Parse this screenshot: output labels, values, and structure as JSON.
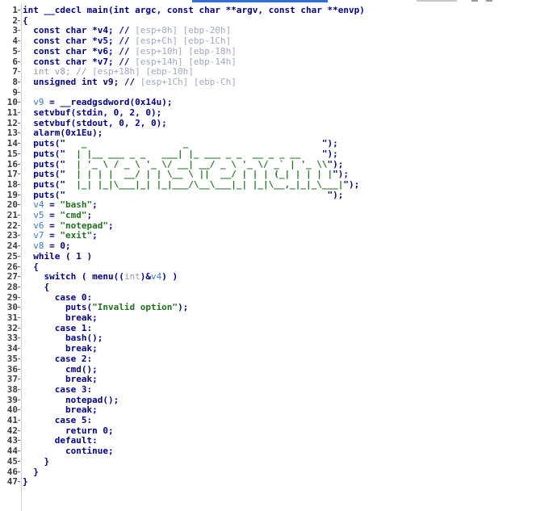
{
  "editor": {
    "lines": [
      {
        "n": "1",
        "t": [
          [
            "int __cdecl main(int argc, const char **argv, const char **envp)",
            "ty"
          ]
        ]
      },
      {
        "n": "2",
        "t": [
          [
            "{",
            "ty"
          ]
        ]
      },
      {
        "n": "3",
        "t": [
          [
            "  const char *v4; // ",
            "ty"
          ],
          [
            "[esp+8h] [ebp-20h]",
            "cm"
          ]
        ]
      },
      {
        "n": "4",
        "t": [
          [
            "  const char *v5; // ",
            "ty"
          ],
          [
            "[esp+Ch] [ebp-1Ch]",
            "cm"
          ]
        ]
      },
      {
        "n": "5",
        "t": [
          [
            "  const char *v6; // ",
            "ty"
          ],
          [
            "[esp+10h] [ebp-18h]",
            "cm"
          ]
        ]
      },
      {
        "n": "6",
        "t": [
          [
            "  const char *v7; // ",
            "ty"
          ],
          [
            "[esp+14h] [ebp-14h]",
            "cm"
          ]
        ]
      },
      {
        "n": "7",
        "t": [
          [
            "  int v8; // ",
            "mu"
          ],
          [
            "[esp+18h] [ebp-10h]",
            "cm"
          ]
        ]
      },
      {
        "n": "8",
        "t": [
          [
            "  unsigned int v9; // ",
            "ty"
          ],
          [
            "[esp+1Ch] [ebp-Ch]",
            "cm"
          ]
        ]
      },
      {
        "n": "9",
        "t": [
          [
            "",
            "ty"
          ]
        ]
      },
      {
        "n": "10",
        "t": [
          [
            "  ",
            "ty"
          ],
          [
            "v9",
            "vr"
          ],
          [
            " = __readgsdword(0x14u);",
            "ty"
          ]
        ]
      },
      {
        "n": "11",
        "t": [
          [
            "  setvbuf(stdin, 0, 2, 0);",
            "ty"
          ]
        ]
      },
      {
        "n": "12",
        "t": [
          [
            "  setvbuf(stdout, 0, 2, 0);",
            "ty"
          ]
        ]
      },
      {
        "n": "13",
        "t": [
          [
            "  alarm(0x1Eu);",
            "ty"
          ]
        ]
      },
      {
        "n": "14",
        "t": [
          [
            "  puts(\"",
            "ty"
          ],
          [
            "   _                  _                         ",
            "st"
          ],
          [
            "\");",
            "ty"
          ]
        ]
      },
      {
        "n": "15",
        "t": [
          [
            "  puts(\"",
            "ty"
          ],
          [
            "  | |__ ___ _ _   ___| |_ ___ _ _  __ _ _ __    ",
            "st"
          ],
          [
            "\");",
            "ty"
          ]
        ]
      },
      {
        "n": "16",
        "t": [
          [
            "  puts(\"",
            "ty"
          ],
          [
            "  | '_ \\ / _ \\ '_ \\/ __| __/ _ \\ '_ \\/ _` | '_ \\\\",
            "st"
          ],
          [
            "\");",
            "ty"
          ]
        ]
      },
      {
        "n": "17",
        "t": [
          [
            "  puts(\"",
            "ty"
          ],
          [
            "  | | | |  __/ | | \\__ \\ ||  __/ | | | (_| | | | |",
            "st"
          ],
          [
            "\");",
            "ty"
          ]
        ]
      },
      {
        "n": "18",
        "t": [
          [
            "  puts(\"",
            "ty"
          ],
          [
            "  |_| |_|\\___|_| |_|___/\\__\\___|_| |_|\\__,_|_|_\\___|",
            "st"
          ],
          [
            "\");",
            "ty"
          ]
        ]
      },
      {
        "n": "19",
        "t": [
          [
            "  puts(\"",
            "ty"
          ],
          [
            "                                                 ",
            "st"
          ],
          [
            "\");",
            "ty"
          ]
        ]
      },
      {
        "n": "20",
        "t": [
          [
            "  ",
            "ty"
          ],
          [
            "v4",
            "vr"
          ],
          [
            " = ",
            "ty"
          ],
          [
            "\"bash\"",
            "st"
          ],
          [
            ";",
            "ty"
          ]
        ]
      },
      {
        "n": "21",
        "t": [
          [
            "  ",
            "ty"
          ],
          [
            "v5",
            "vr"
          ],
          [
            " = ",
            "ty"
          ],
          [
            "\"cmd\"",
            "st"
          ],
          [
            ";",
            "ty"
          ]
        ]
      },
      {
        "n": "22",
        "t": [
          [
            "  ",
            "ty"
          ],
          [
            "v6",
            "vr"
          ],
          [
            " = ",
            "ty"
          ],
          [
            "\"notepad\"",
            "st"
          ],
          [
            ";",
            "ty"
          ]
        ]
      },
      {
        "n": "23",
        "t": [
          [
            "  ",
            "ty"
          ],
          [
            "v7",
            "vr"
          ],
          [
            " = ",
            "ty"
          ],
          [
            "\"exit\"",
            "st"
          ],
          [
            ";",
            "ty"
          ]
        ]
      },
      {
        "n": "24",
        "t": [
          [
            "  ",
            "ty"
          ],
          [
            "v8",
            "vr"
          ],
          [
            " = 0;",
            "ty"
          ]
        ]
      },
      {
        "n": "25",
        "t": [
          [
            "  while ( 1 )",
            "ty"
          ]
        ]
      },
      {
        "n": "26",
        "t": [
          [
            "  {",
            "ty"
          ]
        ]
      },
      {
        "n": "27",
        "t": [
          [
            "    switch ( menu((",
            "ty"
          ],
          [
            "int",
            "mu"
          ],
          [
            ")&",
            "ty"
          ],
          [
            "v4",
            "vr"
          ],
          [
            ") )",
            "ty"
          ]
        ]
      },
      {
        "n": "28",
        "t": [
          [
            "    {",
            "ty"
          ]
        ]
      },
      {
        "n": "29",
        "t": [
          [
            "      case 0:",
            "ty"
          ]
        ]
      },
      {
        "n": "30",
        "t": [
          [
            "        puts(",
            "ty"
          ],
          [
            "\"Invalid option\"",
            "st"
          ],
          [
            ");",
            "ty"
          ]
        ]
      },
      {
        "n": "31",
        "t": [
          [
            "        break;",
            "ty"
          ]
        ]
      },
      {
        "n": "32",
        "t": [
          [
            "      case 1:",
            "ty"
          ]
        ]
      },
      {
        "n": "33",
        "t": [
          [
            "        bash();",
            "ty"
          ]
        ]
      },
      {
        "n": "34",
        "t": [
          [
            "        break;",
            "ty"
          ]
        ]
      },
      {
        "n": "35",
        "t": [
          [
            "      case 2:",
            "ty"
          ]
        ]
      },
      {
        "n": "36",
        "t": [
          [
            "        cmd();",
            "ty"
          ]
        ]
      },
      {
        "n": "37",
        "t": [
          [
            "        break;",
            "ty"
          ]
        ]
      },
      {
        "n": "38",
        "t": [
          [
            "      case 3:",
            "ty"
          ]
        ]
      },
      {
        "n": "39",
        "t": [
          [
            "        notepad();",
            "ty"
          ]
        ]
      },
      {
        "n": "40",
        "t": [
          [
            "        break;",
            "ty"
          ]
        ]
      },
      {
        "n": "41",
        "t": [
          [
            "      case 5:",
            "ty"
          ]
        ]
      },
      {
        "n": "42",
        "t": [
          [
            "        return 0;",
            "ty"
          ]
        ]
      },
      {
        "n": "43",
        "t": [
          [
            "      default:",
            "ty"
          ]
        ]
      },
      {
        "n": "44",
        "t": [
          [
            "        continue;",
            "ty"
          ]
        ]
      },
      {
        "n": "45",
        "t": [
          [
            "    }",
            "ty"
          ]
        ]
      },
      {
        "n": "46",
        "t": [
          [
            "  }",
            "ty"
          ]
        ]
      },
      {
        "n": "47",
        "t": [
          [
            "}",
            "ty"
          ]
        ]
      }
    ]
  }
}
